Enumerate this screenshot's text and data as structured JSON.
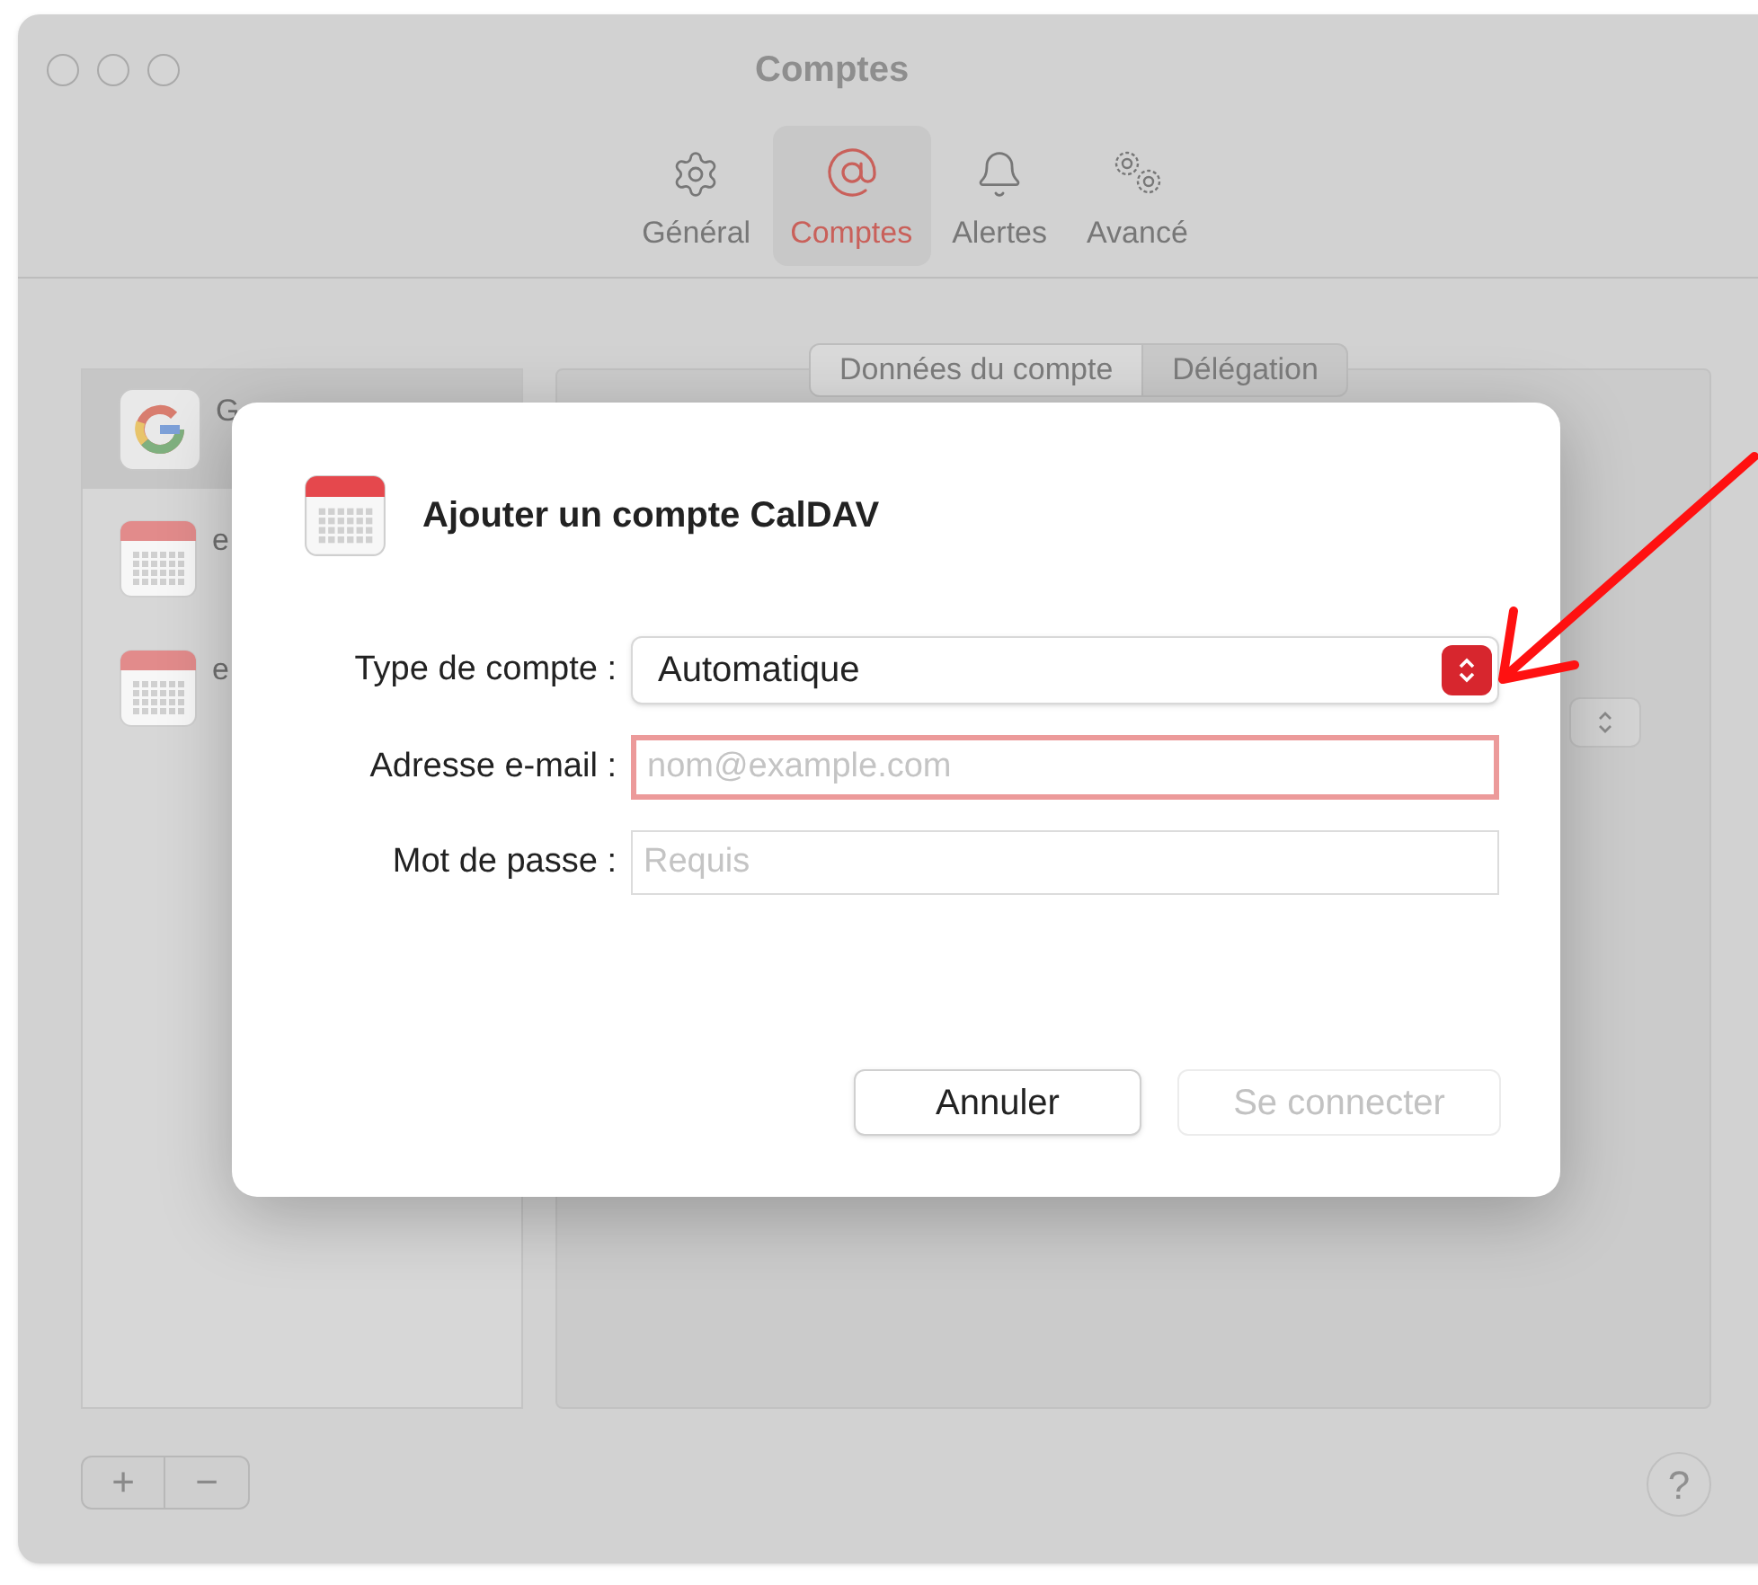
{
  "window": {
    "title": "Comptes"
  },
  "toolbar": {
    "tabs": [
      {
        "label": "Général",
        "selected": false
      },
      {
        "label": "Comptes",
        "selected": true
      },
      {
        "label": "Alertes",
        "selected": false
      },
      {
        "label": "Avancé",
        "selected": false
      }
    ]
  },
  "account_list": {
    "items": [
      {
        "kind": "google",
        "name": "G",
        "selected": true
      },
      {
        "kind": "calendar",
        "name": "e",
        "selected": false
      },
      {
        "kind": "calendar",
        "name": "e",
        "selected": false
      }
    ]
  },
  "detail_tabs": [
    {
      "label": "Données du compte",
      "selected": true
    },
    {
      "label": "Délégation",
      "selected": false
    }
  ],
  "list_buttons": [
    "+",
    "−"
  ],
  "help": "?",
  "dialog": {
    "title": "Ajouter un compte CalDAV",
    "fields": [
      {
        "kind": "select",
        "label": "Type de compte :",
        "value": "Automatique"
      },
      {
        "kind": "text",
        "label": "Adresse e-mail :",
        "placeholder": "nom@example.com",
        "invalid": true
      },
      {
        "kind": "password",
        "label": "Mot de passe :",
        "placeholder": "Requis",
        "invalid": false
      }
    ],
    "buttons": [
      {
        "label": "Annuler",
        "disabled": false
      },
      {
        "label": "Se connecter",
        "disabled": true
      }
    ]
  }
}
